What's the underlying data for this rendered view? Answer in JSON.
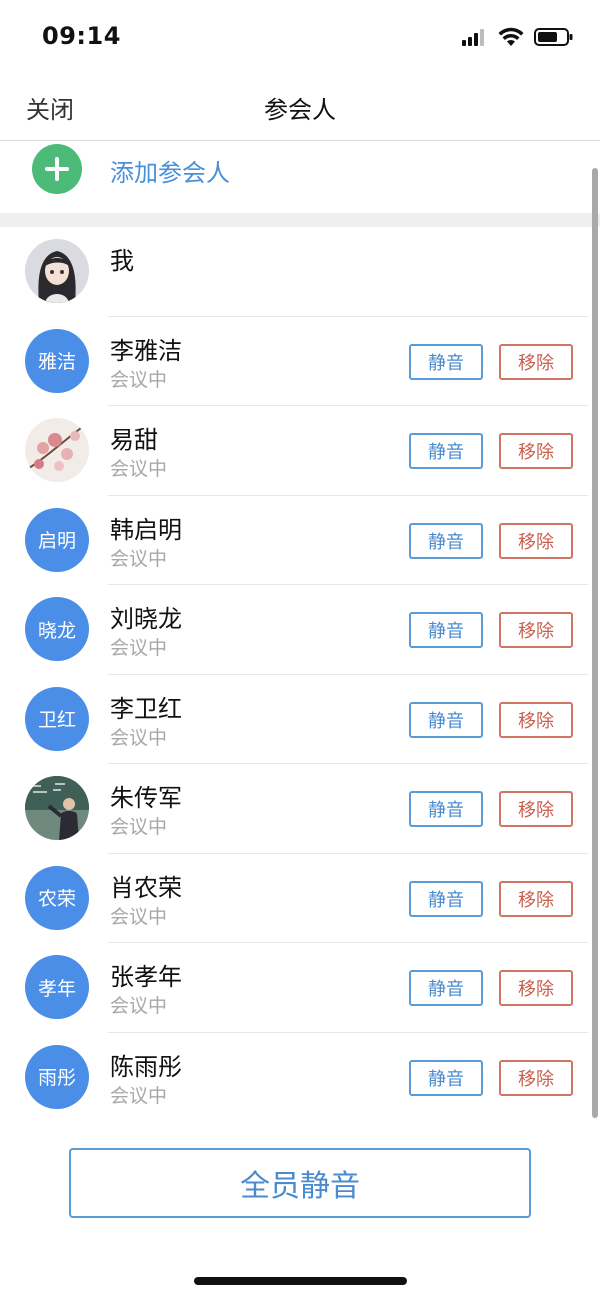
{
  "status_bar": {
    "time": "09:14",
    "icons": [
      "signal-icon",
      "wifi-icon",
      "battery-icon"
    ]
  },
  "nav": {
    "close_label": "关闭",
    "title": "参会人"
  },
  "add_participant": {
    "label": "添加参会人",
    "icon": "plus-circle-icon",
    "icon_color": "#4cbb78"
  },
  "participants": [
    {
      "name": "我",
      "status": "",
      "avatar_type": "photo",
      "avatar_desc": "anime-girl-avatar",
      "show_actions": false
    },
    {
      "name": "李雅洁",
      "status": "会议中",
      "avatar_type": "text",
      "avatar_text": "雅洁",
      "show_actions": true
    },
    {
      "name": "易甜",
      "status": "会议中",
      "avatar_type": "photo",
      "avatar_desc": "flower-avatar",
      "show_actions": true
    },
    {
      "name": "韩启明",
      "status": "会议中",
      "avatar_type": "text",
      "avatar_text": "启明",
      "show_actions": true
    },
    {
      "name": "刘晓龙",
      "status": "会议中",
      "avatar_type": "text",
      "avatar_text": "晓龙",
      "show_actions": true
    },
    {
      "name": "李卫红",
      "status": "会议中",
      "avatar_type": "text",
      "avatar_text": "卫红",
      "show_actions": true
    },
    {
      "name": "朱传军",
      "status": "会议中",
      "avatar_type": "photo",
      "avatar_desc": "teacher-avatar",
      "show_actions": true
    },
    {
      "name": "肖农荣",
      "status": "会议中",
      "avatar_type": "text",
      "avatar_text": "农荣",
      "show_actions": true
    },
    {
      "name": "张孝年",
      "status": "会议中",
      "avatar_type": "text",
      "avatar_text": "孝年",
      "show_actions": true
    },
    {
      "name": "陈雨彤",
      "status": "会议中",
      "avatar_type": "text",
      "avatar_text": "雨彤",
      "show_actions": true
    }
  ],
  "actions": {
    "mute_label": "静音",
    "remove_label": "移除"
  },
  "mute_all_label": "全员静音",
  "colors": {
    "accent_blue": "#4a8ee8",
    "mute_border": "#5a9bd8",
    "remove_border": "#d07463",
    "add_green": "#4cbb78",
    "status_gray": "#a8a8a8"
  }
}
